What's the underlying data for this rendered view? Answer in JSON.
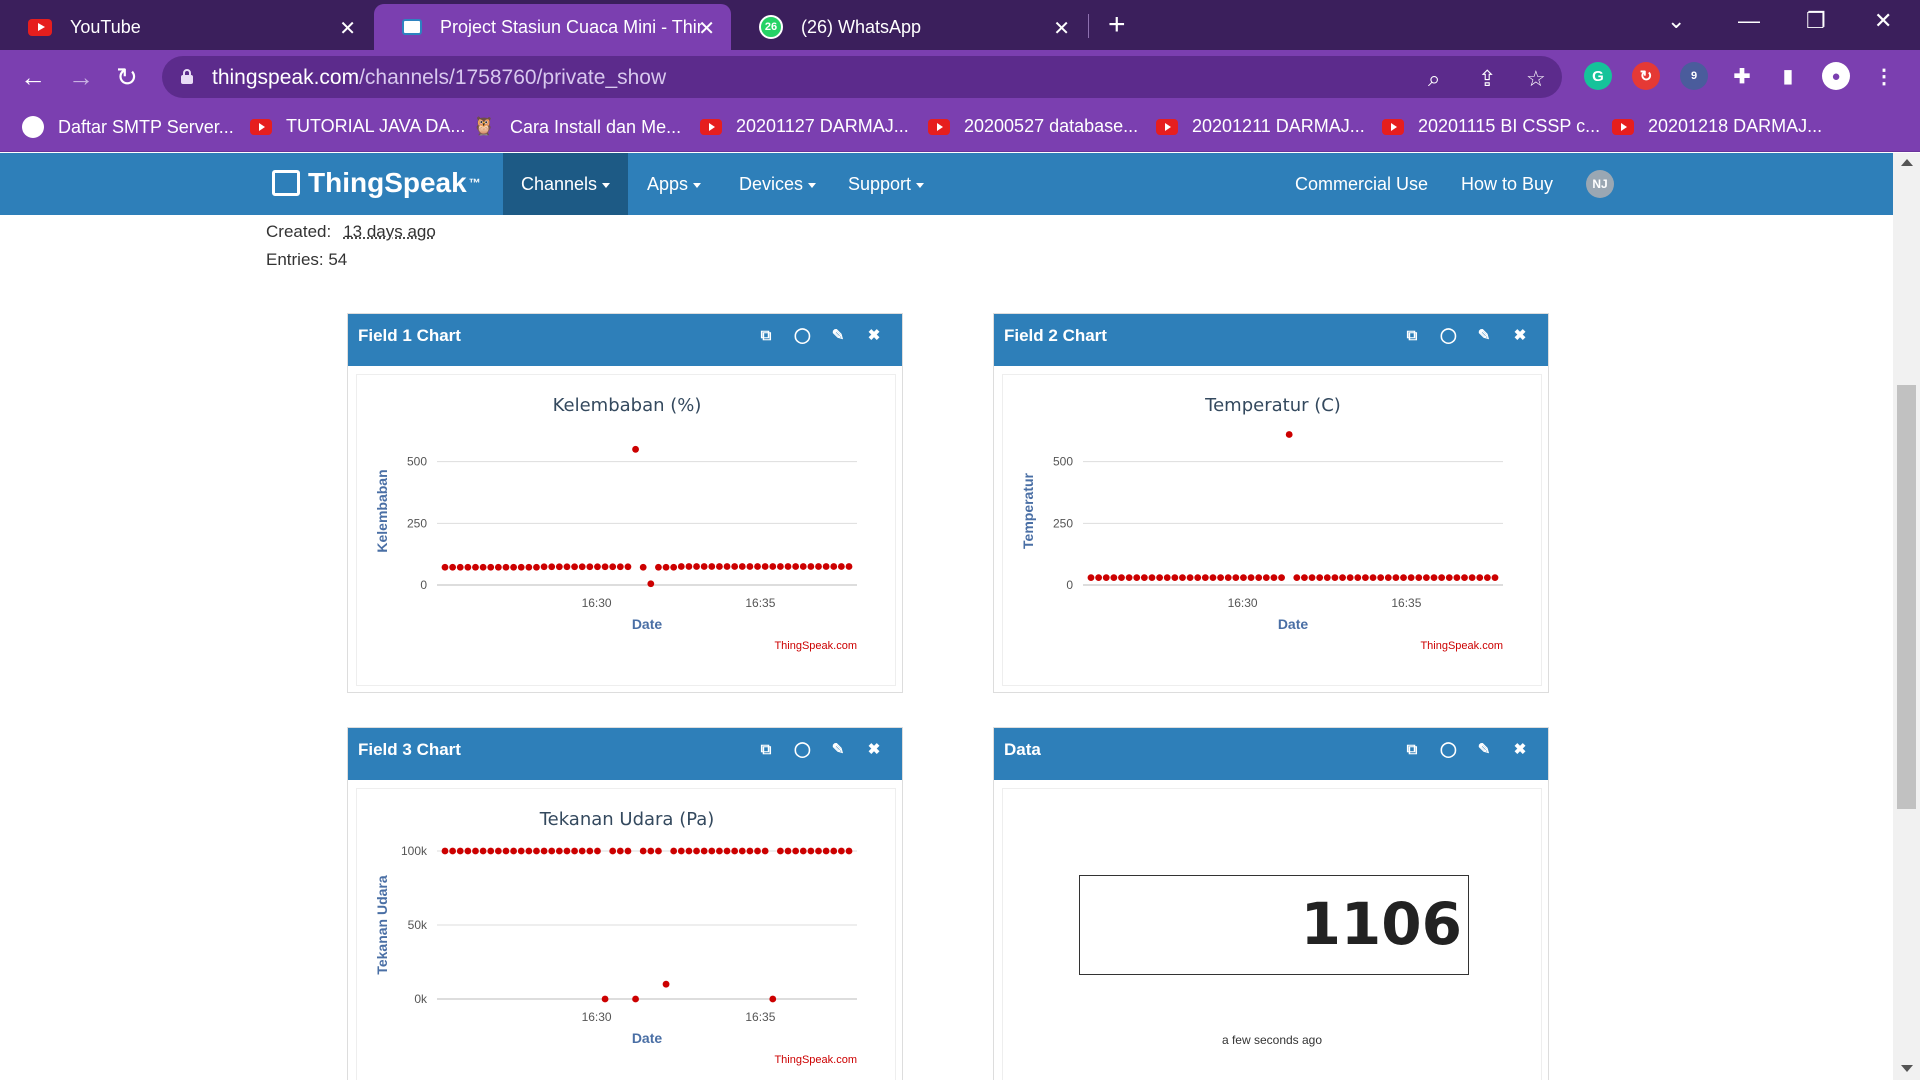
{
  "browser": {
    "tabs": [
      {
        "title": "YouTube",
        "icon": "youtube-icon"
      },
      {
        "title": "Project Stasiun Cuaca Mini - ThingSpeak IoT",
        "icon": "thingspeak-icon",
        "active": true
      },
      {
        "title": "(26) WhatsApp",
        "icon": "whatsapp-icon",
        "badge": "26"
      }
    ],
    "url_host": "thingspeak.com",
    "url_path": "/channels/1758760/private_show",
    "extension_badge": "9",
    "bookmarks": [
      "Daftar SMTP Server...",
      "TUTORIAL JAVA DA...",
      "Cara Install dan Me...",
      "20201127 DARMAJ...",
      "20200527 database...",
      "20201211 DARMAJ...",
      "20201115 BI CSSP c...",
      "20201218 DARMAJ..."
    ]
  },
  "site": {
    "logo": "ThingSpeak",
    "logo_tm": "™",
    "nav": [
      "Channels",
      "Apps",
      "Devices",
      "Support"
    ],
    "nav_right": [
      "Commercial Use",
      "How to Buy"
    ],
    "avatar": "NJ"
  },
  "channel": {
    "created_label": "Created:",
    "created_value": "13 days ago",
    "entries_label": "Entries: 54"
  },
  "panels": {
    "field1": {
      "header": "Field 1 Chart"
    },
    "field2": {
      "header": "Field 2 Chart"
    },
    "field3": {
      "header": "Field 3 Chart"
    },
    "data": {
      "header": "Data",
      "value": "1106",
      "updated": "a few seconds ago"
    }
  },
  "colors": {
    "accent": "#2e7fb9",
    "point": "#cc0000",
    "browser": "#7b3fb0"
  },
  "chart_data": [
    {
      "type": "scatter",
      "title": "Kelembaban (%)",
      "xlabel": "Date",
      "ylabel": "Kelembaban",
      "ylim": [
        0,
        600
      ],
      "yticks": [
        "0",
        "250",
        "500"
      ],
      "xticks": [
        "16:30",
        "16:35"
      ],
      "credit": "ThingSpeak.com",
      "series": [
        {
          "values": [
            72,
            72,
            72,
            72,
            72,
            72,
            72,
            72,
            72,
            72,
            72,
            72,
            72,
            74,
            74,
            74,
            74,
            74,
            74,
            74,
            74,
            74,
            74,
            74,
            74,
            550,
            72,
            5,
            72,
            72,
            72,
            75,
            75,
            75,
            75,
            75,
            75,
            75,
            75,
            75,
            75,
            75,
            75,
            75,
            75,
            75,
            75,
            75,
            75,
            75,
            75,
            75,
            75,
            75
          ]
        }
      ]
    },
    {
      "type": "scatter",
      "title": "Temperatur (C)",
      "xlabel": "Date",
      "ylabel": "Temperatur",
      "ylim": [
        0,
        600
      ],
      "yticks": [
        "0",
        "250",
        "500"
      ],
      "xticks": [
        "16:30",
        "16:35"
      ],
      "credit": "ThingSpeak.com",
      "series": [
        {
          "values": [
            30,
            30,
            30,
            30,
            30,
            30,
            30,
            30,
            30,
            30,
            30,
            30,
            30,
            30,
            30,
            30,
            30,
            30,
            30,
            30,
            30,
            30,
            30,
            30,
            30,
            30,
            610,
            30,
            30,
            30,
            30,
            30,
            30,
            30,
            30,
            30,
            30,
            30,
            30,
            30,
            30,
            30,
            30,
            30,
            30,
            30,
            30,
            30,
            30,
            30,
            30,
            30,
            30,
            30
          ]
        }
      ]
    },
    {
      "type": "scatter",
      "title": "Tekanan Udara (Pa)",
      "xlabel": "Date",
      "ylabel": "Tekanan Udara",
      "ylim": [
        0,
        100000
      ],
      "yticks": [
        "0k",
        "50k",
        "100k"
      ],
      "xticks": [
        "16:30",
        "16:35"
      ],
      "credit": "ThingSpeak.com",
      "series": [
        {
          "values": [
            100000,
            100000,
            100000,
            100000,
            100000,
            100000,
            100000,
            100000,
            100000,
            100000,
            100000,
            100000,
            100000,
            100000,
            100000,
            100000,
            100000,
            100000,
            100000,
            100000,
            100000,
            0,
            100000,
            100000,
            100000,
            0,
            100000,
            100000,
            100000,
            10000,
            100000,
            100000,
            100000,
            100000,
            100000,
            100000,
            100000,
            100000,
            100000,
            100000,
            100000,
            100000,
            100000,
            0,
            100000,
            100000,
            100000,
            100000,
            100000,
            100000,
            100000,
            100000,
            100000,
            100000
          ]
        }
      ]
    }
  ]
}
